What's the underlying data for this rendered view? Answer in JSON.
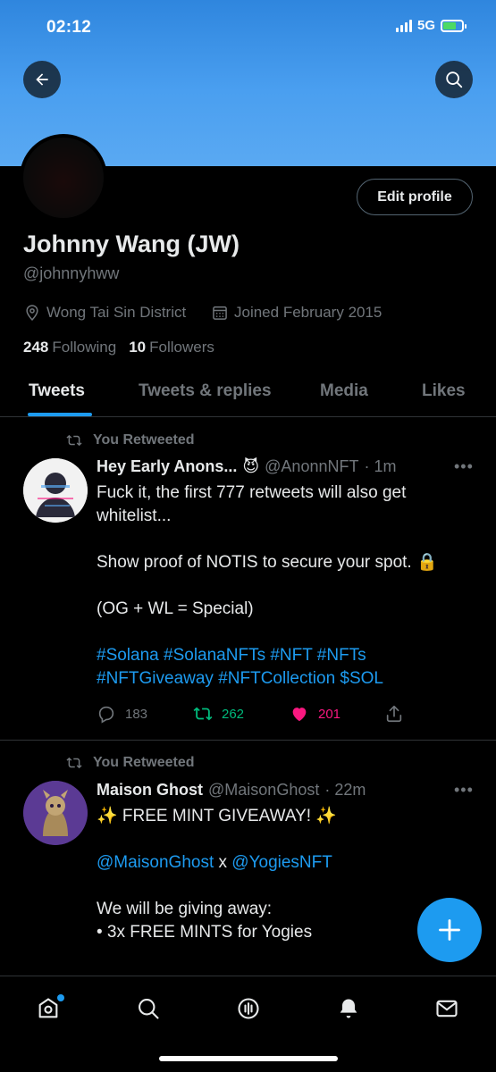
{
  "status_bar": {
    "time": "02:12",
    "network": "5G"
  },
  "profile": {
    "name": "Johnny Wang (JW)",
    "handle": "@johnnyhww",
    "location": "Wong Tai Sin District",
    "joined": "Joined February 2015",
    "following_count": "248",
    "following_label": "Following",
    "followers_count": "10",
    "followers_label": "Followers",
    "edit_label": "Edit profile"
  },
  "tabs": [
    "Tweets",
    "Tweets & replies",
    "Media",
    "Likes"
  ],
  "tweets": [
    {
      "retweet_label": "You Retweeted",
      "name": "Hey Early Anons...",
      "name_emoji": "😈",
      "handle": "@AnonnNFT",
      "time": "· 1m",
      "line1": "Fuck it, the first 777 retweets will also get",
      "line2": "whitelist...",
      "line3": "Show proof of NOTIS to secure your spot.",
      "line3_emoji": "🔒",
      "line4": "(OG + WL = Special)",
      "hashtags1": "#Solana #SolanaNFTs #NFT #NFTs",
      "hashtags2": "#NFTGiveaway #NFTCollection $SOL",
      "replies": "183",
      "retweets": "262",
      "likes": "201"
    },
    {
      "retweet_label": "You Retweeted",
      "name": "Maison Ghost",
      "handle": "@MaisonGhost",
      "time": "· 22m",
      "line1": "✨ FREE MINT GIVEAWAY! ✨",
      "mention1": "@MaisonGhost",
      "x": "x",
      "mention2": "@YogiesNFT",
      "line3": "We will be giving away:",
      "line4": "• 3x FREE MINTS for Yogies"
    }
  ],
  "colors": {
    "accent": "#1d9bf0",
    "like": "#f91880",
    "retweet": "#00ba7c",
    "banner": "#4a9ff0"
  },
  "icons": [
    "back-arrow-icon",
    "search-icon",
    "location-pin-icon",
    "calendar-icon",
    "retweet-icon",
    "reply-icon",
    "heart-icon",
    "share-icon",
    "more-icon",
    "compose-plus-icon",
    "home-icon",
    "explore-icon",
    "spaces-icon",
    "notifications-icon",
    "messages-icon"
  ]
}
